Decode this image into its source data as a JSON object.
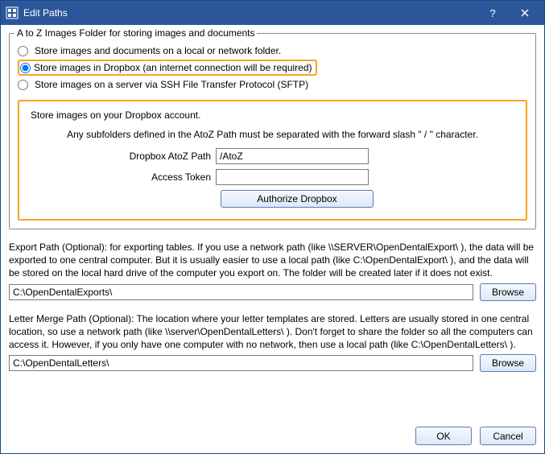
{
  "window": {
    "title": "Edit Paths"
  },
  "group": {
    "title": "A to Z Images Folder for storing images and documents",
    "radio_local": "Store images and documents on a local or network folder.",
    "radio_dropbox": "Store images in Dropbox (an internet connection will be required)",
    "radio_sftp": "Store images on a server via SSH File Transfer Protocol (SFTP)"
  },
  "dropbox": {
    "desc": "Store images on your Dropbox account.",
    "note": "Any subfolders defined in the AtoZ Path must be separated with the forward slash \" / \" character.",
    "path_label": "Dropbox AtoZ Path",
    "path_value": "/AtoZ",
    "token_label": "Access Token",
    "token_value": "",
    "authorize": "Authorize Dropbox"
  },
  "export": {
    "text": "Export Path (Optional): for exporting tables.  If you use a network path (like \\\\SERVER\\OpenDentalExport\\ ), the data will be exported to one central computer.  But it is usually easier to use a local path (like C:\\OpenDentalExport\\ ), and the data will be stored on the local hard drive of the computer you export on.  The folder will be created later if it does not exist.",
    "value": "C:\\OpenDentalExports\\",
    "browse": "Browse"
  },
  "letter": {
    "text": "Letter Merge Path (Optional): The location where your letter templates are stored.  Letters are usually stored in one central location, so use a network path (like \\\\server\\OpenDentalLetters\\ ).  Don't forget to share the folder so all the computers can access it.  However, if you only have one computer with no network, then use a local path (like C:\\OpenDentalLetters\\ ).",
    "value": "C:\\OpenDentalLetters\\",
    "browse": "Browse"
  },
  "footer": {
    "ok": "OK",
    "cancel": "Cancel"
  }
}
